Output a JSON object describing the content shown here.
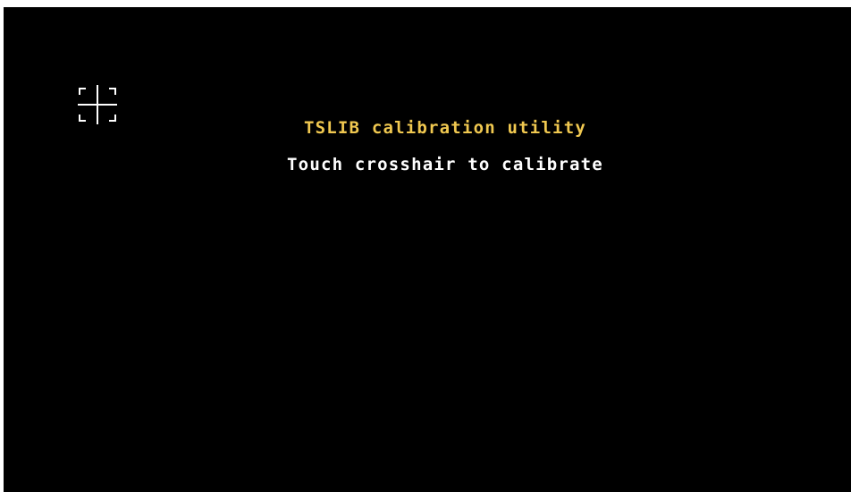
{
  "app": {
    "title": "TSLIB calibration utility",
    "instruction": "Touch crosshair to calibrate"
  },
  "crosshair": {
    "icon": "crosshair-icon"
  },
  "colors": {
    "background": "#000000",
    "title": "#f0c850",
    "instruction": "#ffffff",
    "crosshair": "#ffffff"
  }
}
